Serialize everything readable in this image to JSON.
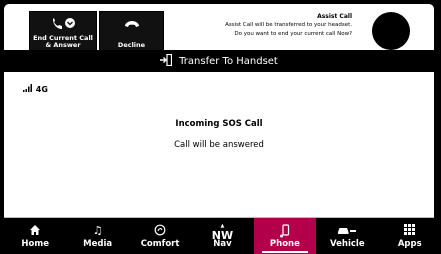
{
  "call_controls": {
    "end_answer_label": "End Current Call & Answer",
    "decline_label": "Decline"
  },
  "notice": {
    "title": "Assist Call",
    "line1": "Assist Call will be transferred to your headset.",
    "line2": "Do you want to end your current call Now?"
  },
  "transfer": {
    "label": "Transfer To Handset"
  },
  "status": {
    "signal": "4G"
  },
  "call": {
    "title": "Incoming SOS Call",
    "subtitle": "Call will be answered"
  },
  "nav": {
    "items": [
      {
        "label": "Home",
        "icon": "home-icon"
      },
      {
        "label": "Media",
        "icon": "music-note-icon"
      },
      {
        "label": "Comfort",
        "icon": "climate-icon"
      },
      {
        "label": "Nav",
        "icon": "compass-icon"
      },
      {
        "label": "Phone",
        "icon": "phone-icon",
        "active": true
      },
      {
        "label": "Vehicle",
        "icon": "car-icon"
      },
      {
        "label": "Apps",
        "icon": "apps-grid-icon"
      }
    ],
    "compass_text": "NW"
  },
  "colors": {
    "accent": "#b3004a",
    "background": "#000000",
    "panel": "#ffffff"
  }
}
